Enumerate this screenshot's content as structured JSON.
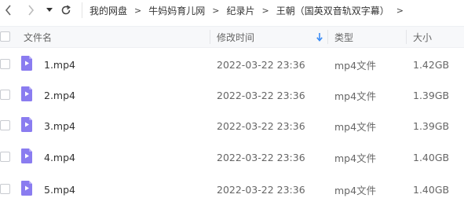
{
  "toolbar": {
    "icons": [
      "back-icon",
      "forward-icon",
      "history-dropdown-icon",
      "refresh-icon"
    ],
    "breadcrumb": [
      "我的网盘",
      "牛妈妈育儿网",
      "纪录片",
      "王朝（国英双音轨双字幕）"
    ],
    "crumb_separator": ">"
  },
  "header": {
    "name": "文件名",
    "modified": "修改时间",
    "type": "类型",
    "size": "大小"
  },
  "files": [
    {
      "name": "1.mp4",
      "modified": "2022-03-22 23:36",
      "type": "mp4文件",
      "size": "1.42GB"
    },
    {
      "name": "2.mp4",
      "modified": "2022-03-22 23:36",
      "type": "mp4文件",
      "size": "1.39GB"
    },
    {
      "name": "3.mp4",
      "modified": "2022-03-22 23:36",
      "type": "mp4文件",
      "size": "1.39GB"
    },
    {
      "name": "4.mp4",
      "modified": "2022-03-22 23:36",
      "type": "mp4文件",
      "size": "1.40GB"
    },
    {
      "name": "5.mp4",
      "modified": "2022-03-22 23:36",
      "type": "mp4文件",
      "size": "1.40GB"
    }
  ],
  "colors": {
    "file_icon": "#8a7cf0",
    "sort_arrow": "#3b8cf5",
    "header_bg": "#f7f8fa"
  }
}
